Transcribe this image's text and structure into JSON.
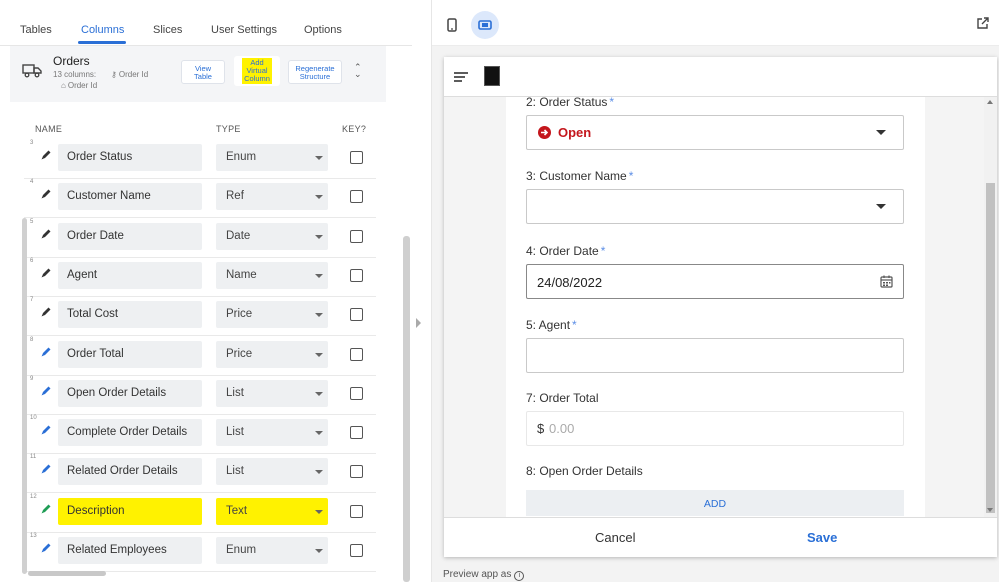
{
  "tabs": [
    "Tables",
    "Columns",
    "Slices",
    "User Settings",
    "Options"
  ],
  "active_tab": "Columns",
  "table_header": {
    "title": "Orders",
    "columns_count": "13 columns:",
    "key_label": "Order Id",
    "label_label": "Order Id",
    "buttons": {
      "view_table": "View\nTable",
      "add_virtual": "Add\nVirtual\nColumn",
      "regenerate": "Regenerate\nStructure"
    }
  },
  "column_headers": {
    "name": "NAME",
    "type": "TYPE",
    "key": "KEY?"
  },
  "rows": [
    {
      "num": "3",
      "name": "Order Status",
      "type": "Enum",
      "pencil": "dark"
    },
    {
      "num": "4",
      "name": "Customer Name",
      "type": "Ref",
      "pencil": "dark"
    },
    {
      "num": "5",
      "name": "Order Date",
      "type": "Date",
      "pencil": "dark"
    },
    {
      "num": "6",
      "name": "Agent",
      "type": "Name",
      "pencil": "dark"
    },
    {
      "num": "7",
      "name": "Total Cost",
      "type": "Price",
      "pencil": "dark"
    },
    {
      "num": "8",
      "name": "Order Total",
      "type": "Price",
      "pencil": "blue"
    },
    {
      "num": "9",
      "name": "Open Order Details",
      "type": "List",
      "pencil": "blue"
    },
    {
      "num": "10",
      "name": "Complete Order Details",
      "type": "List",
      "pencil": "blue"
    },
    {
      "num": "11",
      "name": "Related Order Details",
      "type": "List",
      "pencil": "blue"
    },
    {
      "num": "12",
      "name": "Description",
      "type": "Text",
      "pencil": "green",
      "highlight": true
    },
    {
      "num": "13",
      "name": "Related Employees",
      "type": "Enum",
      "pencil": "blue"
    }
  ],
  "preview": {
    "fields": {
      "status_label": "2: Order Status",
      "status_value": "Open",
      "customer_label": "3: Customer Name",
      "date_label": "4: Order Date",
      "date_value": "24/08/2022",
      "agent_label": "5: Agent",
      "total_label": "7: Order Total",
      "total_currency": "$",
      "total_placeholder": "0.00",
      "open_details_label": "8: Open Order Details",
      "add_label": "ADD"
    },
    "required_mark": "*",
    "cancel": "Cancel",
    "save": "Save",
    "note": "Preview app as",
    "info_glyph": "i"
  },
  "colors": {
    "accent": "#2a6fd6",
    "highlight": "#fff200",
    "status_red": "#c4161c"
  }
}
